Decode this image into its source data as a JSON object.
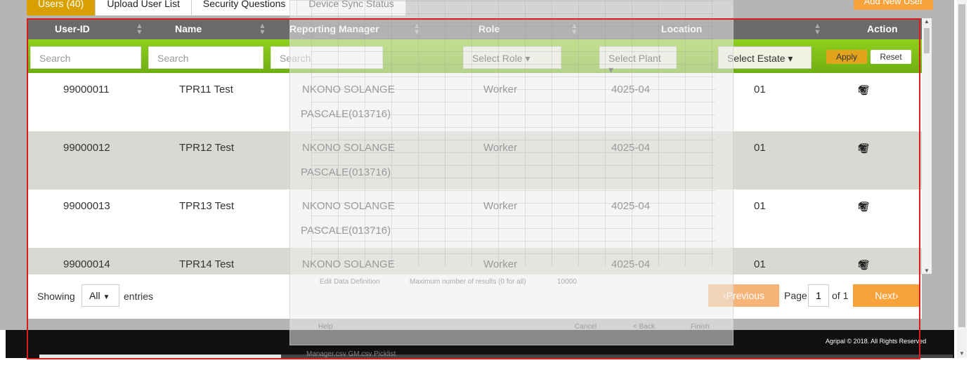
{
  "tabs": [
    "Users (40)",
    "Upload User List",
    "Security Questions",
    "Device Sync Status"
  ],
  "add_user_label": "Add New User",
  "columns": {
    "user_id": "User-ID",
    "name": "Name",
    "manager": "Reporting Manager",
    "role": "Role",
    "location": "Location",
    "action": "Action"
  },
  "filters": {
    "search1": "Search",
    "search2": "Search",
    "search3": "Search",
    "role": "Select Role ▾",
    "plant": "Select Plant ▾",
    "estate": "Select Estate ▾",
    "apply": "Apply",
    "reset": "Reset"
  },
  "rows": [
    {
      "id": "99000011",
      "name": "TPR11 Test",
      "mgr1": "NKONO SOLANGE",
      "mgr2": "PASCALE(013716)",
      "role": "Worker",
      "plant": "4025-04",
      "estate": "01"
    },
    {
      "id": "99000012",
      "name": "TPR12 Test",
      "mgr1": "NKONO SOLANGE",
      "mgr2": "PASCALE(013716)",
      "role": "Worker",
      "plant": "4025-04",
      "estate": "01"
    },
    {
      "id": "99000013",
      "name": "TPR13 Test",
      "mgr1": "NKONO SOLANGE",
      "mgr2": "PASCALE(013716)",
      "role": "Worker",
      "plant": "4025-04",
      "estate": "01"
    },
    {
      "id": "99000014",
      "name": "TPR14 Test",
      "mgr1": "NKONO SOLANGE",
      "mgr2": "",
      "role": "Worker",
      "plant": "4025-04",
      "estate": "01"
    }
  ],
  "icons": {
    "edit": "pencil-icon",
    "mail": "envelope-icon",
    "delete": "trash-icon"
  },
  "pager": {
    "showing": "Showing",
    "entries_value": "All",
    "entries": "entries",
    "prev": "‹Previous",
    "page": "Page",
    "page_num": "1",
    "of": "of 1",
    "next": "Next›"
  },
  "copyright": "Agripal © 2018. All Rights Reserved",
  "overlay": {
    "edit_def": "Edit Data Definition",
    "max_results": "Maximum number of results (0 for all)",
    "max_value": "10000",
    "help": "Help",
    "cancel": "Cancel",
    "back": "< Back",
    "finish": "Finish",
    "bottom_tabs": "Manager.csv   GM.csv   Picklist"
  },
  "colors": {
    "accent": "#f7a23b",
    "filter_green": "#8fcf1d",
    "header_gray": "#6a6a6a",
    "frame_red": "#d81e1e"
  }
}
